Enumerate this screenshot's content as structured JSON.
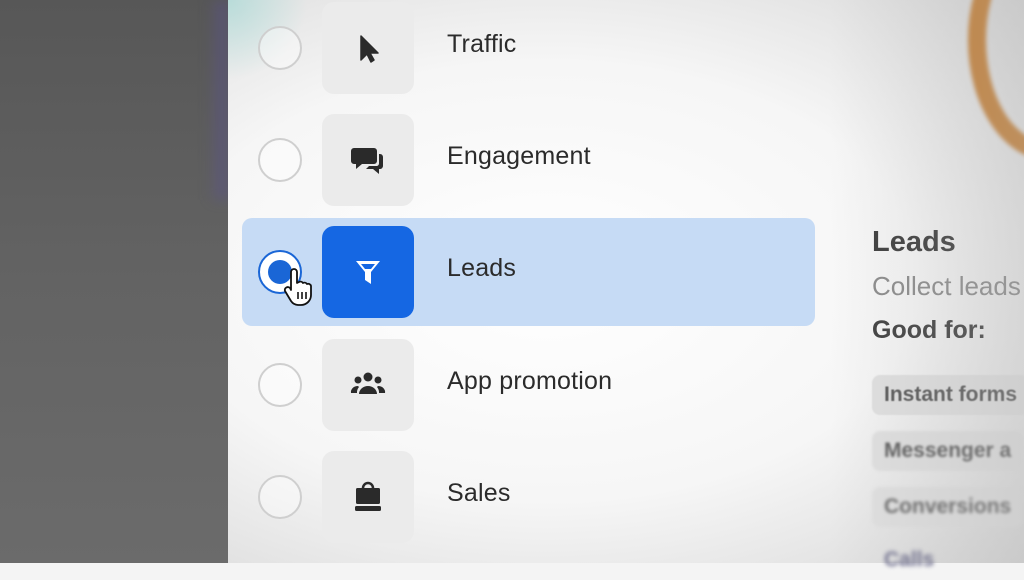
{
  "objectives": [
    {
      "label": "Traffic",
      "icon": "cursor-icon",
      "selected": false
    },
    {
      "label": "Engagement",
      "icon": "chat-bubbles-icon",
      "selected": false
    },
    {
      "label": "Leads",
      "icon": "funnel-icon",
      "selected": true
    },
    {
      "label": "App promotion",
      "icon": "people-icon",
      "selected": false
    },
    {
      "label": "Sales",
      "icon": "shopping-bag-icon",
      "selected": false
    }
  ],
  "detail": {
    "title": "Leads",
    "description": "Collect leads",
    "good_for_label": "Good for:",
    "chips": [
      "Instant forms",
      "Messenger a",
      "Conversions",
      "Calls"
    ]
  },
  "colors": {
    "accent": "#1567e3",
    "selected_row_bg": "#c6dbf5",
    "tile_bg": "#ebebeb"
  }
}
